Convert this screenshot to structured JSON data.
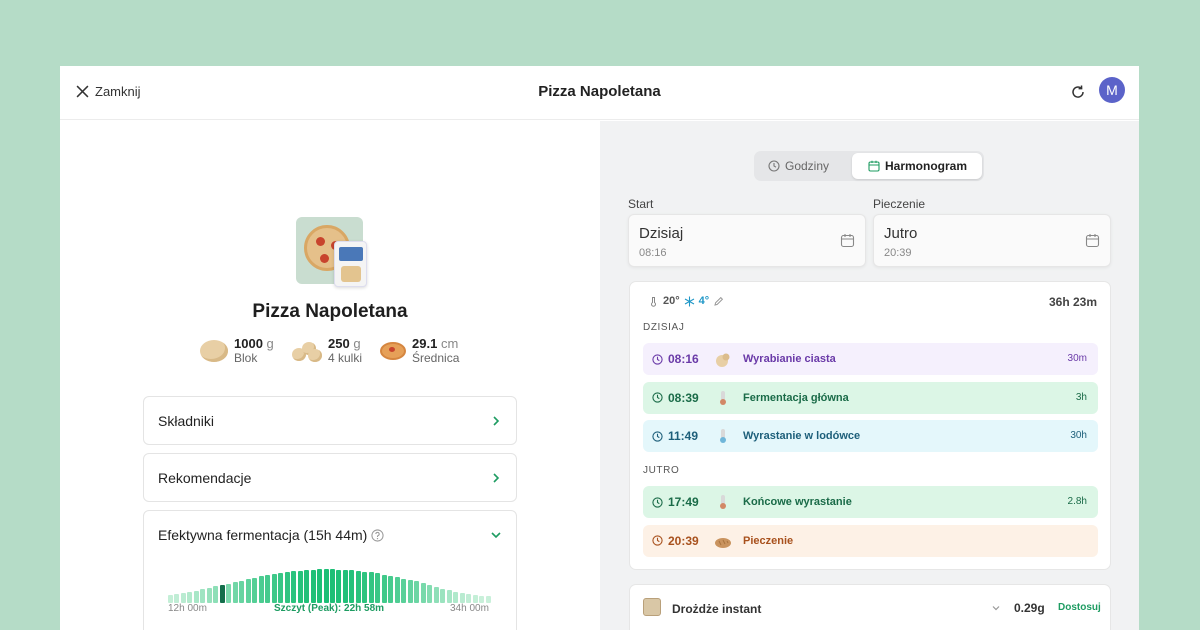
{
  "header": {
    "close_label": "Zamknij",
    "title": "Pizza Napoletana",
    "avatar_initial": "M"
  },
  "recipe": {
    "title": "Pizza Napoletana",
    "stats": [
      {
        "value": "1000",
        "unit": "g",
        "label": "Blok"
      },
      {
        "value": "250",
        "unit": "g",
        "label": "4 kulki"
      },
      {
        "value": "29.1",
        "unit": "cm",
        "label": "Średnica"
      }
    ]
  },
  "sections": {
    "ingredients": "Składniki",
    "recommendations": "Rekomendacje",
    "fermentation": "Efektywna fermentacja (15h 44m)"
  },
  "chart_data": {
    "type": "bar",
    "x_start_label": "12h 00m",
    "x_end_label": "34h 00m",
    "peak_label": "Szczyt (Peak): 22h 58m",
    "values": [
      0.22,
      0.24,
      0.27,
      0.3,
      0.34,
      0.38,
      0.42,
      0.46,
      0.5,
      0.54,
      0.58,
      0.62,
      0.66,
      0.7,
      0.74,
      0.77,
      0.8,
      0.83,
      0.86,
      0.88,
      0.9,
      0.92,
      0.93,
      0.94,
      0.94,
      0.94,
      0.93,
      0.92,
      0.91,
      0.89,
      0.87,
      0.85,
      0.82,
      0.79,
      0.76,
      0.72,
      0.68,
      0.64,
      0.6,
      0.55,
      0.5,
      0.45,
      0.4,
      0.35,
      0.31,
      0.27,
      0.24,
      0.22,
      0.2,
      0.19
    ],
    "highlight_index": 8,
    "colors": {
      "highlight": "#136e4b",
      "peak": "#1dbf76",
      "low": "#c9f0da"
    }
  },
  "toggle": {
    "hours_label": "Godziny",
    "schedule_label": "Harmonogram"
  },
  "start": {
    "label": "Start",
    "day": "Dzisiaj",
    "time": "08:16"
  },
  "bake": {
    "label": "Pieczenie",
    "day": "Jutro",
    "time": "20:39"
  },
  "schedule": {
    "warm_temp": "20°",
    "cold_temp": "4°",
    "total": "36h 23m",
    "today_label": "DZISIAJ",
    "tomorrow_label": "JUTRO",
    "today": [
      {
        "time": "08:16",
        "name": "Wyrabianie ciasta",
        "duration": "30m",
        "icon": "dough-icon",
        "bg": "#f5f0fd",
        "fg": "#6a3aa8"
      },
      {
        "time": "08:39",
        "name": "Fermentacja główna",
        "duration": "3h",
        "icon": "thermometer-icon",
        "bg": "#dcf6e6",
        "fg": "#1a6b48"
      },
      {
        "time": "11:49",
        "name": "Wyrastanie w lodówce",
        "duration": "30h",
        "icon": "thermometer-cold-icon",
        "bg": "#e4f7fb",
        "fg": "#1d5f7a"
      }
    ],
    "tomorrow": [
      {
        "time": "17:49",
        "name": "Końcowe wyrastanie",
        "duration": "2.8h",
        "icon": "thermometer-icon",
        "bg": "#dcf6e6",
        "fg": "#1a6b48"
      },
      {
        "time": "20:39",
        "name": "Pieczenie",
        "duration": "",
        "icon": "bread-icon",
        "bg": "#fdf1e6",
        "fg": "#a8511d"
      }
    ]
  },
  "yeast": {
    "name": "Drożdże instant",
    "amount": "0.29g",
    "adjust_label": "Dostosuj"
  }
}
